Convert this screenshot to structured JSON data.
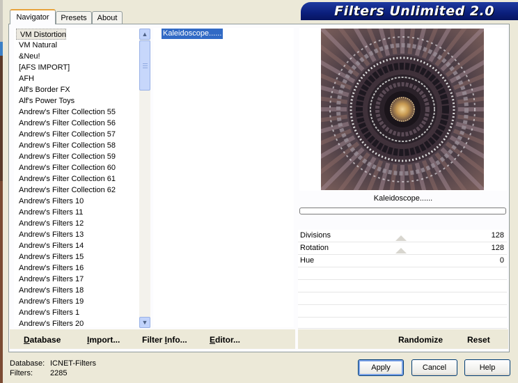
{
  "title": "Filters Unlimited 2.0",
  "tabs": [
    "Navigator",
    "Presets",
    "About"
  ],
  "categories": [
    "VM Distortion",
    "VM Natural",
    "&Neu!",
    "[AFS IMPORT]",
    "AFH",
    "Alf's Border FX",
    "Alf's Power Toys",
    "Andrew's Filter Collection 55",
    "Andrew's Filter Collection 56",
    "Andrew's Filter Collection 57",
    "Andrew's Filter Collection 58",
    "Andrew's Filter Collection 59",
    "Andrew's Filter Collection 60",
    "Andrew's Filter Collection 61",
    "Andrew's Filter Collection 62",
    "Andrew's Filters 10",
    "Andrew's Filters 11",
    "Andrew's Filters 12",
    "Andrew's Filters 13",
    "Andrew's Filters 14",
    "Andrew's Filters 15",
    "Andrew's Filters 16",
    "Andrew's Filters 17",
    "Andrew's Filters 18",
    "Andrew's Filters 19",
    "Andrew's Filters 1",
    "Andrew's Filters 20"
  ],
  "selected_category": "VM Distortion",
  "filters": [
    "Kaleidoscope......"
  ],
  "preview_filter_name": "Kaleidoscope......",
  "parameters": [
    {
      "name": "Divisions",
      "value": "128"
    },
    {
      "name": "Rotation",
      "value": "128"
    },
    {
      "name": "Hue",
      "value": "0"
    }
  ],
  "toolbar_left": {
    "database": "Database",
    "import": "Import...",
    "filter_info": "Filter Info...",
    "editor": "Editor..."
  },
  "toolbar_right": {
    "randomize": "Randomize",
    "reset": "Reset"
  },
  "status": {
    "database_label": "Database:",
    "database_value": "ICNET-Filters",
    "filters_label": "Filters:",
    "filters_value": "2285"
  },
  "dialog_buttons": {
    "apply": "Apply",
    "cancel": "Cancel",
    "help": "Help"
  },
  "colors": {
    "banner": "#0b1f7c",
    "selection": "#316ac5",
    "active_tab_accent": "#e8a33d"
  }
}
